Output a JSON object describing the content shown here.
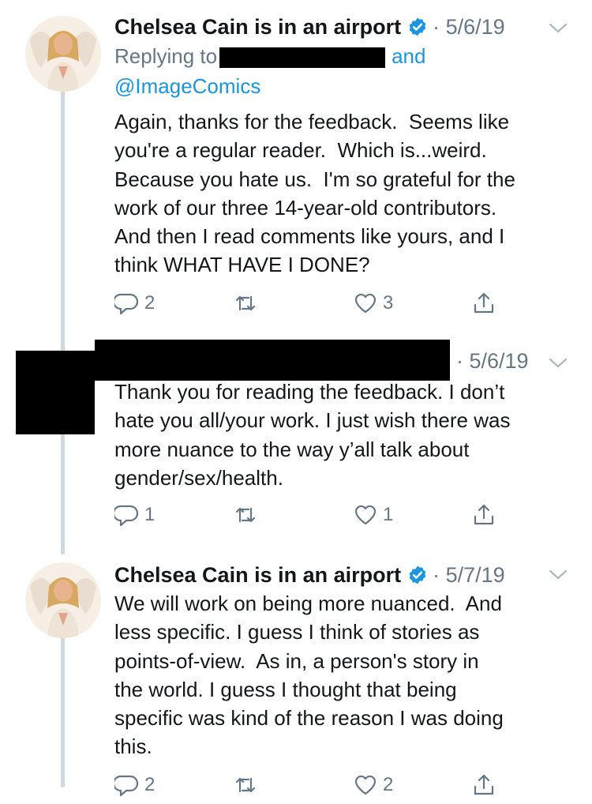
{
  "tweets": [
    {
      "name": "Chelsea Cain is in an airport",
      "date": "· 5/6/19",
      "replying_label": "Replying to",
      "replying_and": "and",
      "replying_handle": "@ImageComics",
      "text": "Again, thanks for the feedback.  Seems like\nyou're a regular reader.  Which is...weird.\nBecause you hate us.  I'm so grateful for the\nwork of our three 14-year-old contributors.\nAnd then I read comments like yours, and I\nthink WHAT HAVE I DONE?",
      "reply_count": "2",
      "retweet_count": "",
      "like_count": "3"
    },
    {
      "date": "· 5/6/19",
      "text": "Thank you for reading the feedback. I don’t\nhate you all/your work. I just wish there was\nmore nuance to the way y’all talk about\ngender/sex/health.",
      "reply_count": "1",
      "retweet_count": "",
      "like_count": "1"
    },
    {
      "name": "Chelsea Cain is in an airport",
      "date": "· 5/7/19",
      "text": "We will work on being more nuanced.  And\nless specific. I guess I think of stories as\npoints-of-view.  As in, a person's story in\nthe world. I guess I thought that being\nspecific was kind of the reason I was doing\nthis.",
      "reply_count": "2",
      "retweet_count": "",
      "like_count": "2"
    }
  ],
  "colors": {
    "accent": "#1b95e0",
    "muted": "#657786",
    "text": "#14171a",
    "line": "#cfd9de"
  },
  "icons": [
    "verified-badge-icon",
    "chevron-down-icon",
    "reply-icon",
    "retweet-icon",
    "like-icon",
    "share-icon"
  ]
}
